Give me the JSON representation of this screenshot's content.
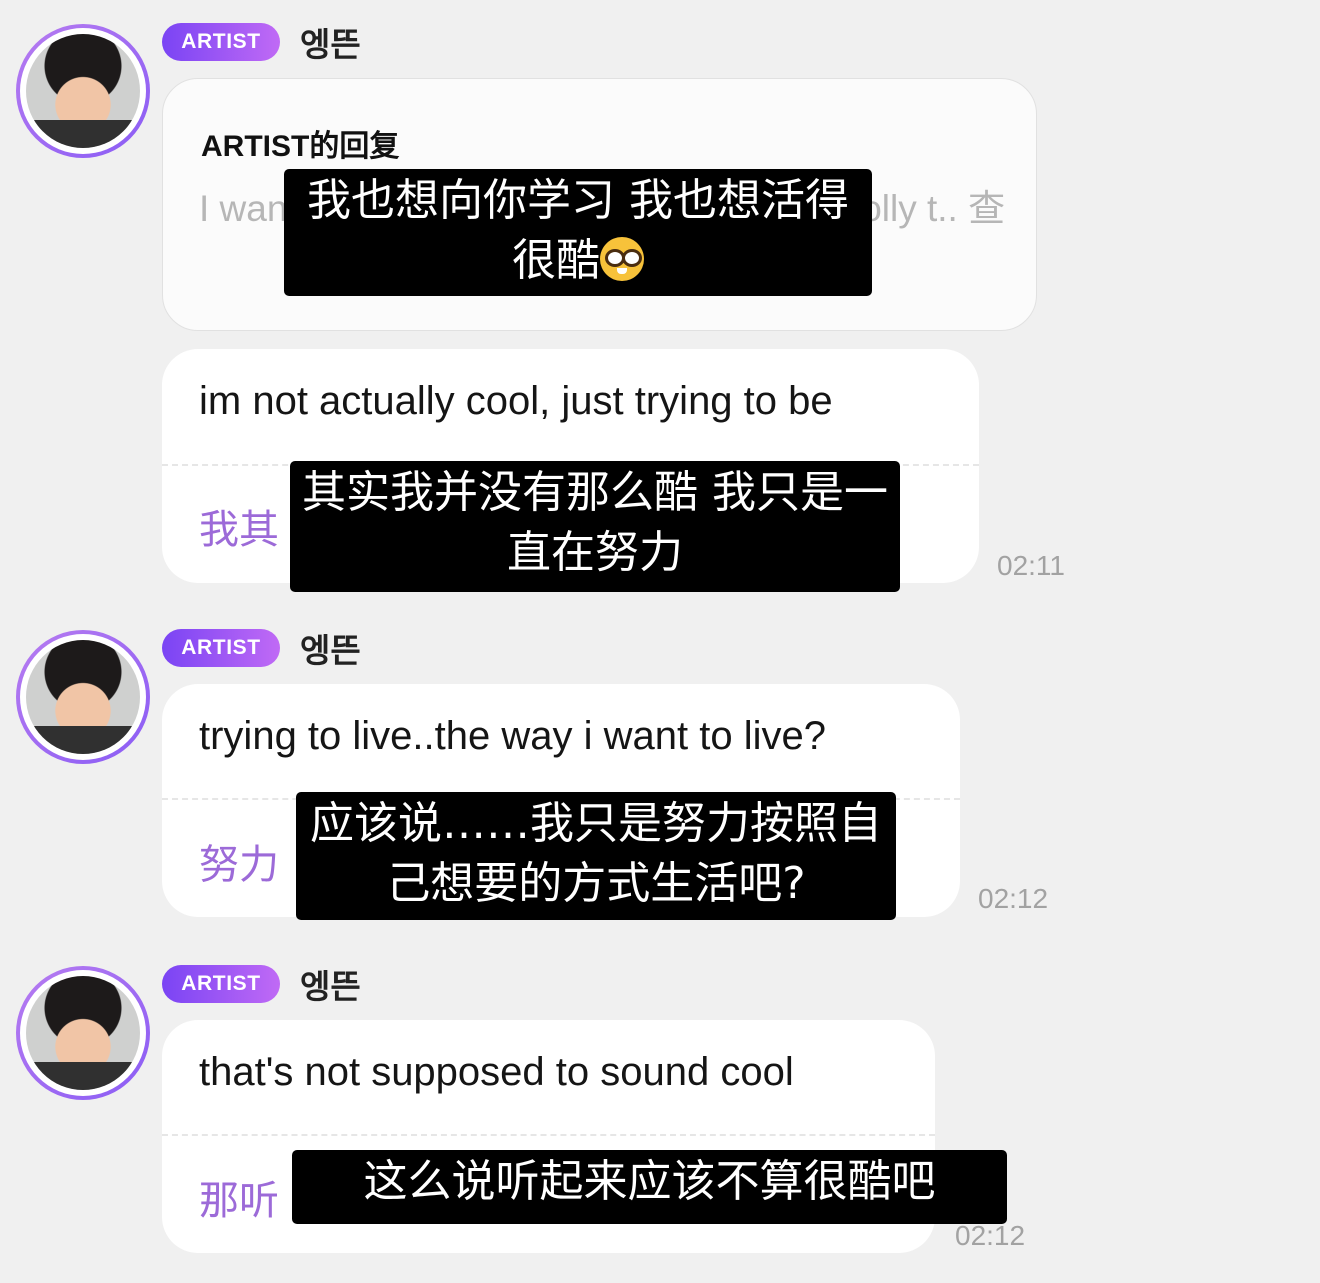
{
  "messages": [
    {
      "badge": "ARTIST",
      "author": "엥뜬",
      "reply": {
        "title": "ARTIST的回复",
        "text": "I want to learn from you, I want to live coolly t.. 查"
      },
      "subtitle_reply": "我也想向你学习 我也想活得很酷",
      "text": "im not actually cool, just trying to be",
      "translation": "我其",
      "subtitle": "其实我并没有那么酷 我只是一直在努力",
      "time": "02:11"
    },
    {
      "badge": "ARTIST",
      "author": "엥뜬",
      "text": "trying to live..the way i want to live?",
      "translation": "努力",
      "subtitle": "应该说……我只是努力按照自己想要的方式生活吧?",
      "time": "02:12"
    },
    {
      "badge": "ARTIST",
      "author": "엥뜬",
      "text": "that's not supposed to sound cool",
      "translation": "那听",
      "subtitle": "这么说听起来应该不算很酷吧",
      "time": "02:12"
    }
  ],
  "icons": {
    "avatar": "profile-photo",
    "reply_emoji": "nerd-face-emoji"
  },
  "colors": {
    "badge_start": "#7a44f4",
    "badge_end": "#c06af5",
    "translation": "#9c6ad8",
    "background": "#f0f0f0"
  }
}
